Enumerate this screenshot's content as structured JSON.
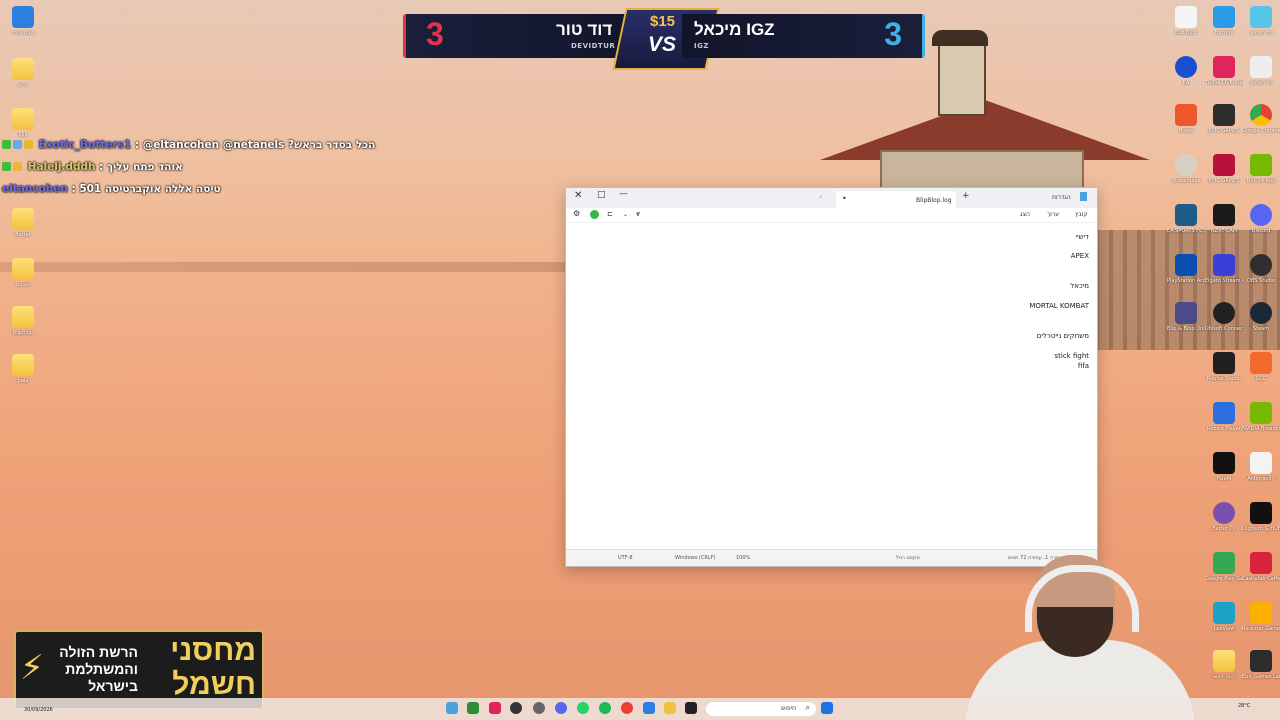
{
  "scoreboard": {
    "left_score": "3",
    "left_name": "דוד טור",
    "left_sub": "DEVIDTUR",
    "prize": "$15",
    "vs": "VS",
    "right_name": "מיכאל IGZ",
    "right_sub": "IGZ",
    "right_score": "3"
  },
  "chat": [
    {
      "user": "Exotic_Butters1",
      "message": ": @eltancohen @netanels ?הכל בסדר בראש"
    },
    {
      "user": "Halelj.dddh",
      "message": ": אוהד פתח עליך"
    },
    {
      "user": "eltancohen",
      "message": ": 501 טיסה אללה אוקברטיסה"
    }
  ],
  "notepad": {
    "tab_title": "BlipBlop.log",
    "menu": {
      "file": "קובץ",
      "edit": "ערוך",
      "view": "הצג"
    },
    "settings_label": "הגדרות",
    "lines": [
      "דישיי",
      "APEX",
      "מיכאל",
      "MORTAL KOMBAT",
      "משחקים נייטרלים",
      "stick fight",
      "fifa"
    ],
    "status": {
      "position": "שורה 1, עמודה 72 תווים",
      "format": "טקסט רגיל",
      "zoom": "100%",
      "line_ending": "Windows (CRLF)",
      "encoding": "UTF-8"
    }
  },
  "banner": {
    "big_line1": "מחסני",
    "big_line2": "חשמל",
    "small_text": "הרשת הזולה והמשתלמת בישראל"
  },
  "desktop_left": [
    {
      "label": "תיבת עזרה"
    },
    {
      "label": "כלים"
    },
    {
      "label": "Klik"
    },
    {
      "label": "Better"
    },
    {
      "label": "תוכנות"
    },
    {
      "label": "BlipBlop"
    },
    {
      "label": "pala"
    }
  ],
  "desktop_right": [
    {
      "label": "Blip Blop"
    },
    {
      "label": "Fortnite"
    },
    {
      "label": "סל המחזור"
    },
    {
      "label": "EA"
    },
    {
      "label": "TikTok LIVE Studio"
    },
    {
      "label": "Brave"
    },
    {
      "label": "EPIC GAMES"
    },
    {
      "label": "Google Chrome"
    },
    {
      "label": "Streamlabs"
    },
    {
      "label": "NVIDIA App"
    },
    {
      "label": "EA SPORTS FC 26"
    },
    {
      "label": "NZXT CAM"
    },
    {
      "label": "Discord"
    },
    {
      "label": "PlayStation Accessories"
    },
    {
      "label": "Elgato Stream Deck"
    },
    {
      "label": "OBS Studio"
    },
    {
      "label": "Blip & Blop Online"
    },
    {
      "label": "Ubisoft Connect"
    },
    {
      "label": "Steam"
    },
    {
      "label": "Roblox Studio"
    },
    {
      "label": "GCC"
    },
    {
      "label": "Roblox Player"
    },
    {
      "label": "NVIDIA Broadcast"
    },
    {
      "label": "FiveM"
    },
    {
      "label": "Antigravity"
    },
    {
      "label": "Better Cli"
    },
    {
      "label": "Logitech G HUB"
    },
    {
      "label": "Google Play Games"
    },
    {
      "label": "Castlefab Caffeinated"
    },
    {
      "label": "LebView"
    },
    {
      "label": "Rockstar Games"
    },
    {
      "label": "קובץ ראשי"
    },
    {
      "label": "Epic Games Launcher"
    }
  ],
  "taskbar": {
    "search_placeholder": "חיפוש",
    "time": "28°C",
    "date": "30/09/2026"
  }
}
